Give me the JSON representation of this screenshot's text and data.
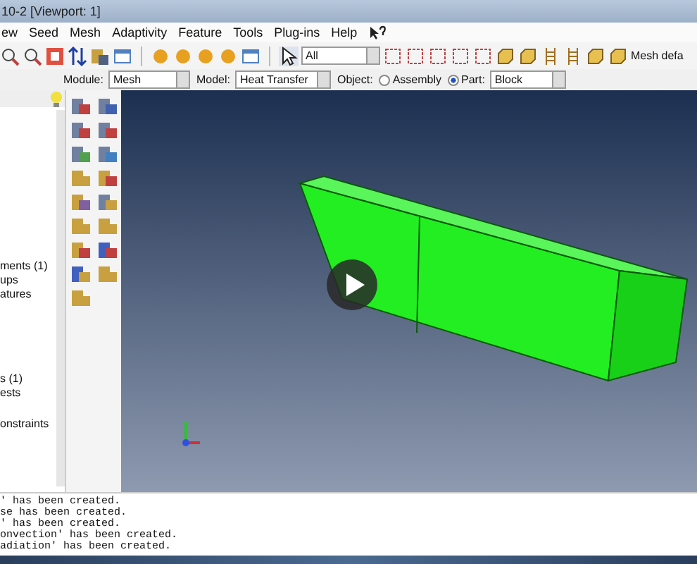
{
  "window": {
    "title": "10-2 [Viewport: 1]"
  },
  "menu": [
    "ew",
    "Seed",
    "Mesh",
    "Adaptivity",
    "Feature",
    "Tools",
    "Plug-ins",
    "Help"
  ],
  "toolbar": {
    "selection_filter": "All",
    "mesh_defaults": "Mesh defa"
  },
  "context": {
    "module_label": "Module:",
    "module": "Mesh",
    "model_label": "Model:",
    "model": "Heat Transfer",
    "object_label": "Object:",
    "objects": [
      {
        "label": "Assembly",
        "selected": false
      },
      {
        "label": "Part:",
        "selected": true
      }
    ],
    "part": "Block"
  },
  "tree": [
    "ments (1)",
    "ups",
    "atures",
    "s (1)",
    "ests",
    "onstraints"
  ],
  "messages": [
    "' has been created.",
    "se has been created.",
    "' has been created.",
    "onvection' has been created.",
    "adiation' has been created."
  ]
}
